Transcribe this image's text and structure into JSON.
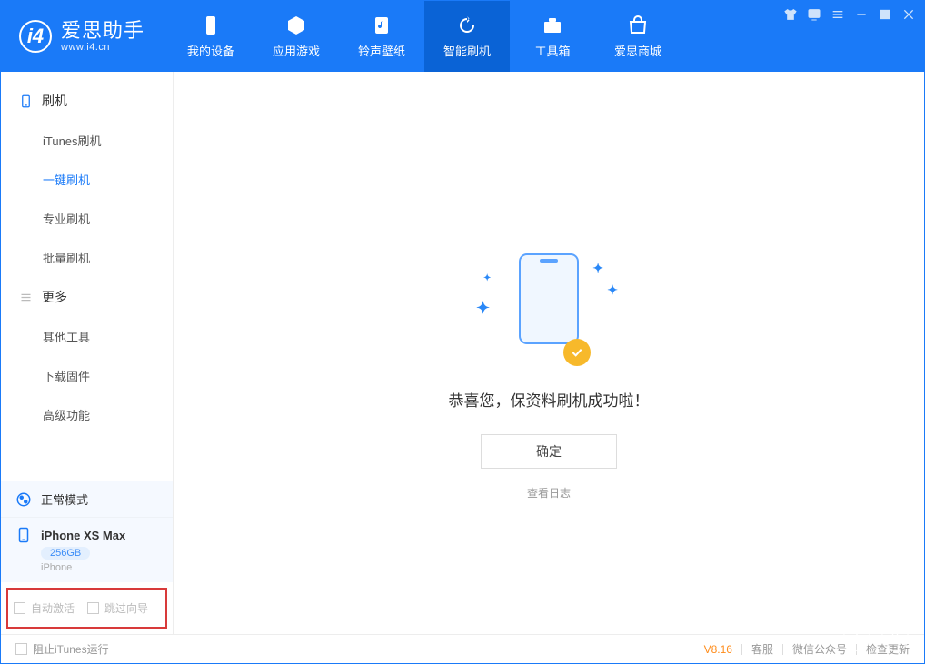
{
  "brand": {
    "name": "爱思助手",
    "url": "www.i4.cn"
  },
  "nav": [
    {
      "label": "我的设备"
    },
    {
      "label": "应用游戏"
    },
    {
      "label": "铃声壁纸"
    },
    {
      "label": "智能刷机"
    },
    {
      "label": "工具箱"
    },
    {
      "label": "爱思商城"
    }
  ],
  "sidebar": {
    "group1": "刷机",
    "items1": [
      "iTunes刷机",
      "一键刷机",
      "专业刷机",
      "批量刷机"
    ],
    "group2": "更多",
    "items2": [
      "其他工具",
      "下载固件",
      "高级功能"
    ]
  },
  "mode": {
    "label": "正常模式"
  },
  "device": {
    "name": "iPhone XS Max",
    "capacity": "256GB",
    "type": "iPhone"
  },
  "options": {
    "auto_activate": "自动激活",
    "skip_guide": "跳过向导"
  },
  "main": {
    "success_text": "恭喜您，保资料刷机成功啦！",
    "ok_button": "确定",
    "view_log": "查看日志"
  },
  "footer": {
    "block_itunes": "阻止iTunes运行",
    "version": "V8.16",
    "support": "客服",
    "wechat": "微信公众号",
    "check_update": "检查更新"
  }
}
